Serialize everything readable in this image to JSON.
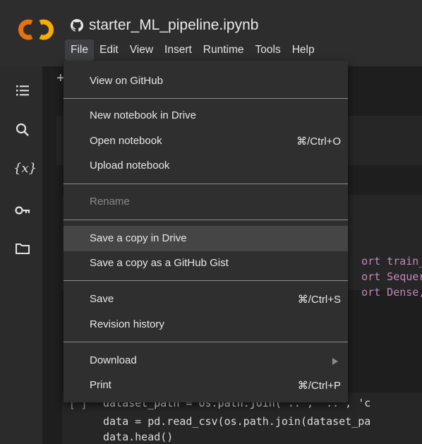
{
  "window": {
    "title": "starter_ML_pipeline.ipynb",
    "logo": "colab-logo",
    "accent_orange": "#f9ab00",
    "accent_orange_dark": "#e8710a"
  },
  "menubar": {
    "items": [
      "File",
      "Edit",
      "View",
      "Insert",
      "Runtime",
      "Tools",
      "Help"
    ],
    "active": "File"
  },
  "sidebar": {
    "icons": [
      "table-of-contents-icon",
      "search-icon",
      "variables-icon",
      "key-icon",
      "folder-icon"
    ],
    "variables_glyph": "{x}"
  },
  "toolbar": {
    "plus": "+"
  },
  "file_menu": {
    "view_on_github": "View on GitHub",
    "new_notebook_in_drive": "New notebook in Drive",
    "open_notebook": "Open notebook",
    "open_notebook_shortcut": "⌘/Ctrl+O",
    "upload_notebook": "Upload notebook",
    "rename": "Rename",
    "save_copy_in_drive": "Save a copy in Drive",
    "save_copy_gist": "Save a copy as a GitHub Gist",
    "save": "Save",
    "save_shortcut": "⌘/Ctrl+S",
    "revision_history": "Revision history",
    "download": "Download",
    "print": "Print",
    "print_shortcut": "⌘/Ctrl+P"
  },
  "code_cell_1": {
    "line1": "ort train_",
    "line2": "ort Sequer",
    "line3": "ort Dense,"
  },
  "code_cell_2": {
    "bracket": "[ ]",
    "line1_partial": "dataset_path = os.path.join('..', '..', 'c",
    "line2": "data = pd.read_csv(os.path.join(dataset_pa",
    "line3": "data.head()"
  }
}
